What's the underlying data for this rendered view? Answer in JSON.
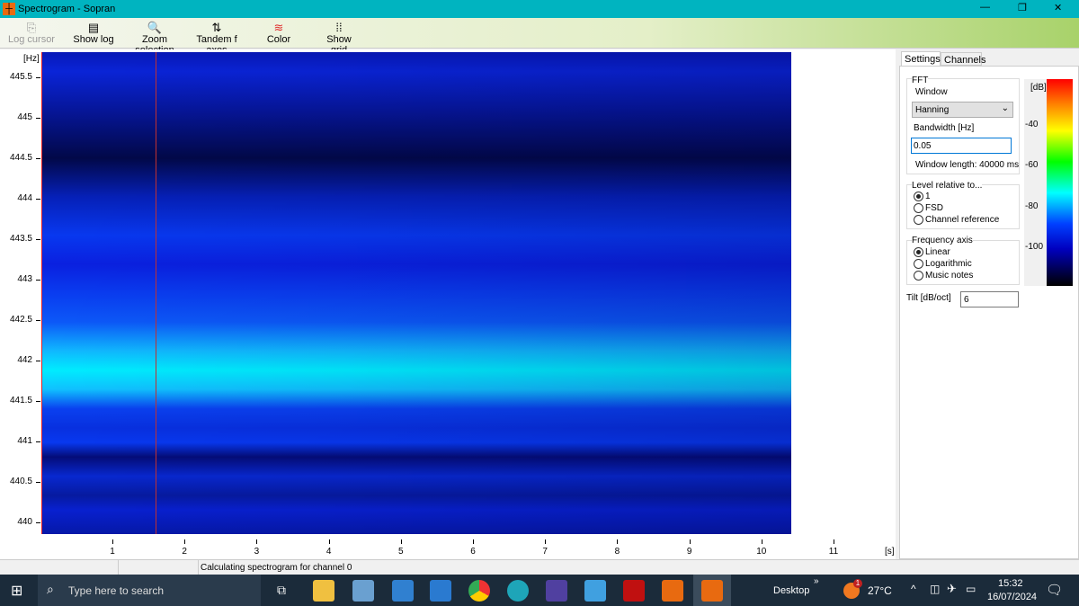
{
  "window": {
    "title": "Spectrogram - Sopran",
    "min": "—",
    "max": "❐",
    "close": "✕"
  },
  "toolbar": [
    {
      "label": "Log cursor",
      "icon": "copy-icon",
      "glyph": "⎘",
      "disabled": true
    },
    {
      "label": "Show log",
      "icon": "log-icon",
      "glyph": "▤"
    },
    {
      "label": "Zoom selection",
      "icon": "magnifier-icon",
      "glyph": "🔍"
    },
    {
      "label": "Tandem f axes",
      "icon": "tandem-icon",
      "glyph": "⇅"
    },
    {
      "label": "Color",
      "icon": "color-icon",
      "glyph": "≋"
    },
    {
      "label": "Show grid",
      "icon": "grid-icon",
      "glyph": "⁞⁞"
    }
  ],
  "plot": {
    "y_unit": "[Hz]",
    "x_unit": "[s]",
    "y_ticks": [
      "445.5",
      "445",
      "444.5",
      "444",
      "443.5",
      "443",
      "442.5",
      "442",
      "441.5",
      "441",
      "440.5",
      "440"
    ],
    "x_ticks": [
      "1",
      "2",
      "3",
      "4",
      "5",
      "6",
      "7",
      "8",
      "9",
      "10",
      "11"
    ],
    "cursor_time_s": 1.58
  },
  "settings": {
    "tabs": [
      "Settings",
      "Channels"
    ],
    "fft_label": "FFT",
    "window_label": "Window",
    "window_value": "Hanning",
    "bandwidth_label": "Bandwidth [Hz]",
    "bandwidth_value": "0.05",
    "window_length": "Window length: 40000 ms",
    "level_label": "Level relative to...",
    "level_options": [
      "1",
      "FSD",
      "Channel reference"
    ],
    "level_selected": 0,
    "freq_axis_label": "Frequency axis",
    "freq_options": [
      "Linear",
      "Logarithmic",
      "Music notes"
    ],
    "freq_selected": 0,
    "tilt_label": "Tilt [dB/oct]",
    "tilt_value": "6"
  },
  "colorbar": {
    "unit": "[dB]",
    "ticks": [
      "-40",
      "-60",
      "-80",
      "-100"
    ]
  },
  "status": {
    "message": "Calculating spectrogram for channel 0"
  },
  "taskbar": {
    "search_placeholder": "Type here to search",
    "desktop": "Desktop",
    "weather": "27°C",
    "weather_badge": "1",
    "time": "15:32",
    "date": "16/07/2024"
  }
}
